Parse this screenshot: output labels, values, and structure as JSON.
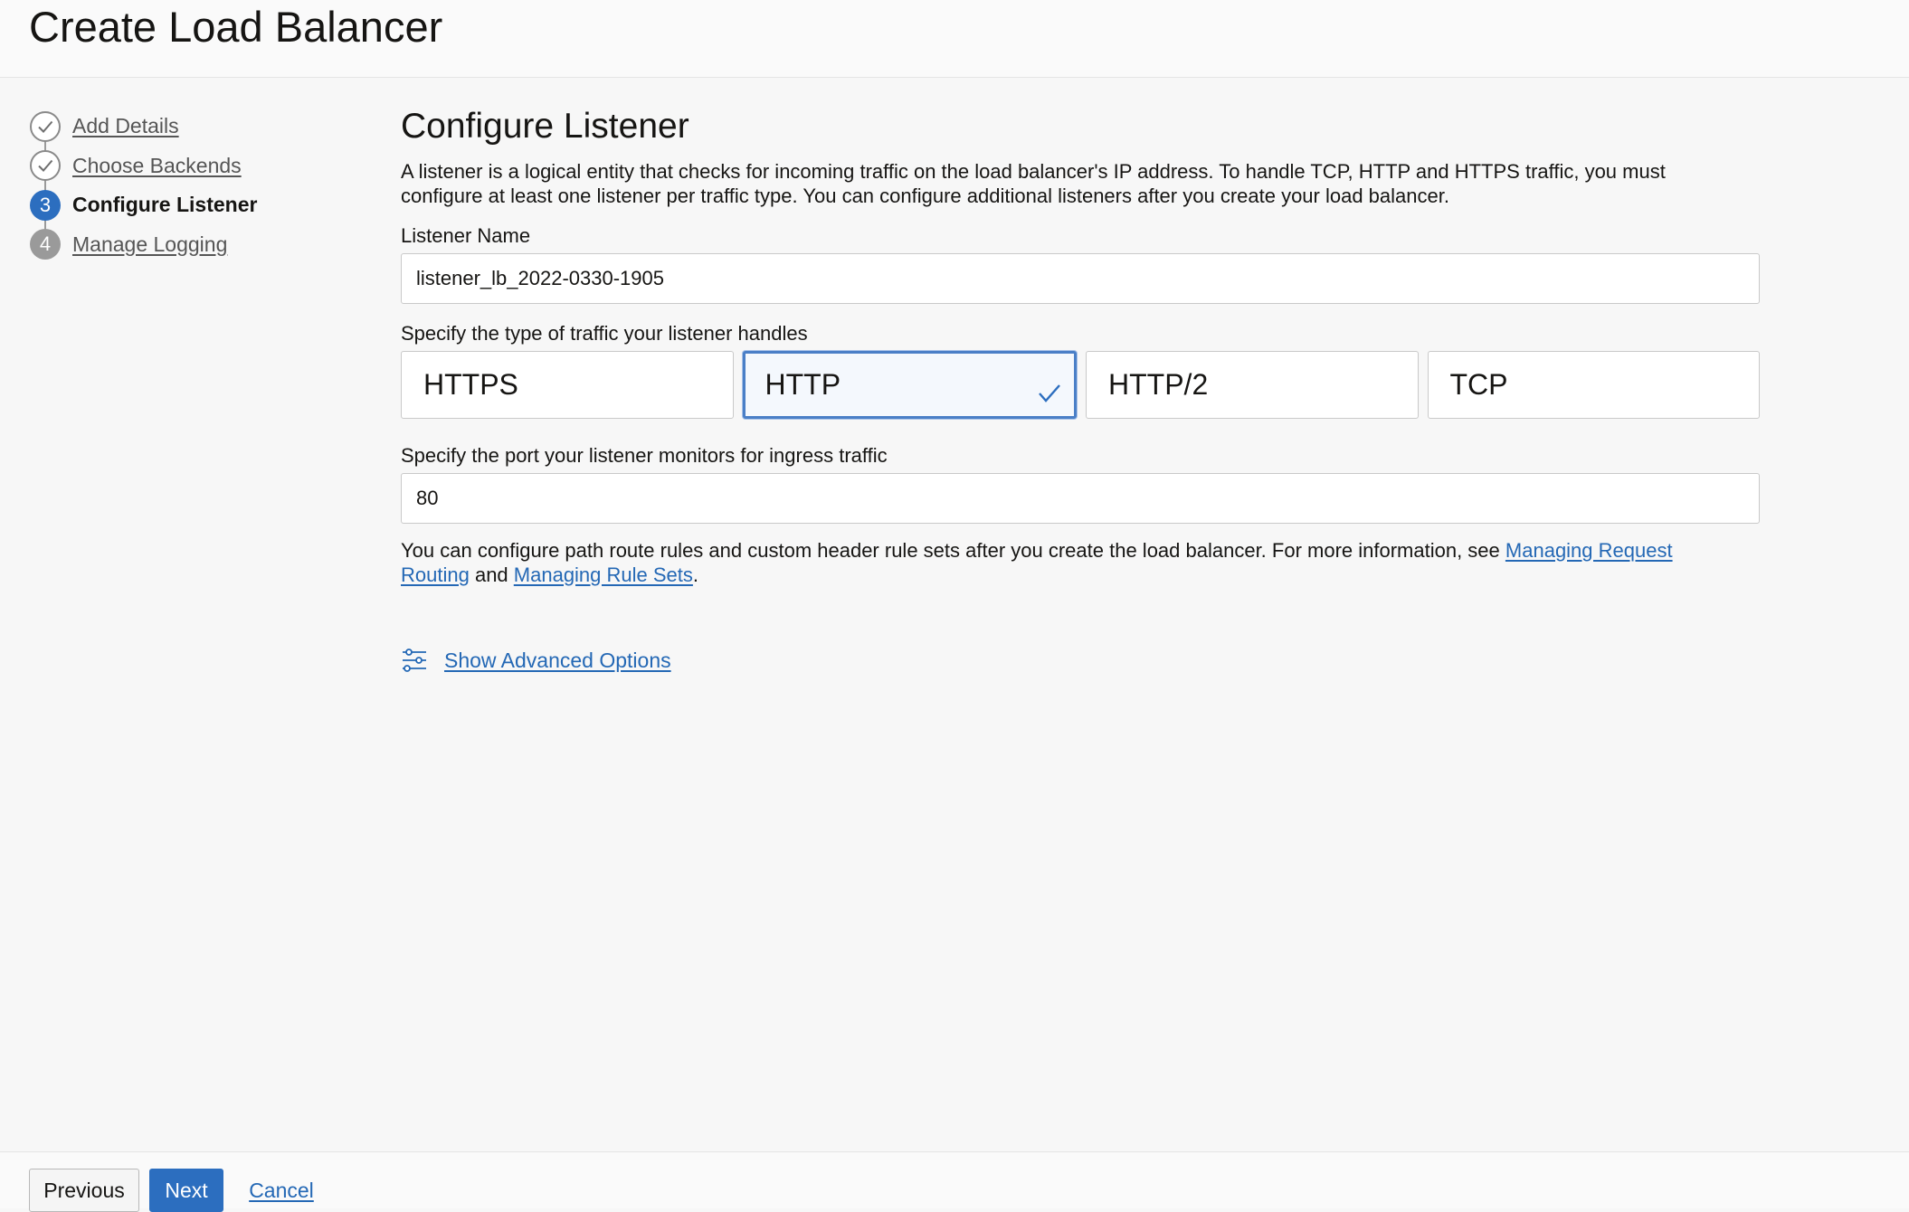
{
  "page": {
    "title": "Create Load Balancer"
  },
  "steps": [
    {
      "label": "Add Details",
      "status": "complete",
      "icon": "check-icon"
    },
    {
      "label": "Choose Backends",
      "status": "complete",
      "icon": "check-icon"
    },
    {
      "label": "Configure Listener",
      "status": "current",
      "number": "3"
    },
    {
      "label": "Manage Logging",
      "status": "upcoming",
      "number": "4"
    }
  ],
  "main": {
    "heading": "Configure Listener",
    "description": "A listener is a logical entity that checks for incoming traffic on the load balancer's IP address. To handle TCP, HTTP and HTTPS traffic, you must configure at least one listener per traffic type. You can configure additional listeners after you create your load balancer.",
    "listener_name": {
      "label": "Listener Name",
      "value": "listener_lb_2022-0330-1905"
    },
    "traffic": {
      "label": "Specify the type of traffic your listener handles",
      "options": [
        "HTTPS",
        "HTTP",
        "HTTP/2",
        "TCP"
      ],
      "selected": "HTTP"
    },
    "port": {
      "label": "Specify the port your listener monitors for ingress traffic",
      "value": "80"
    },
    "note": {
      "text_before": "You can configure path route rules and custom header rule sets after you create the load balancer. For more information, see ",
      "link1": "Managing Request Routing",
      "text_middle": " and ",
      "link2": "Managing Rule Sets",
      "text_after": "."
    },
    "advanced": {
      "label": "Show Advanced Options",
      "icon": "sliders-icon"
    }
  },
  "footer": {
    "previous": "Previous",
    "next": "Next",
    "cancel": "Cancel"
  },
  "colors": {
    "accent": "#2c6ebf",
    "link": "#2468b5",
    "selected_border": "#4a7fc7"
  }
}
